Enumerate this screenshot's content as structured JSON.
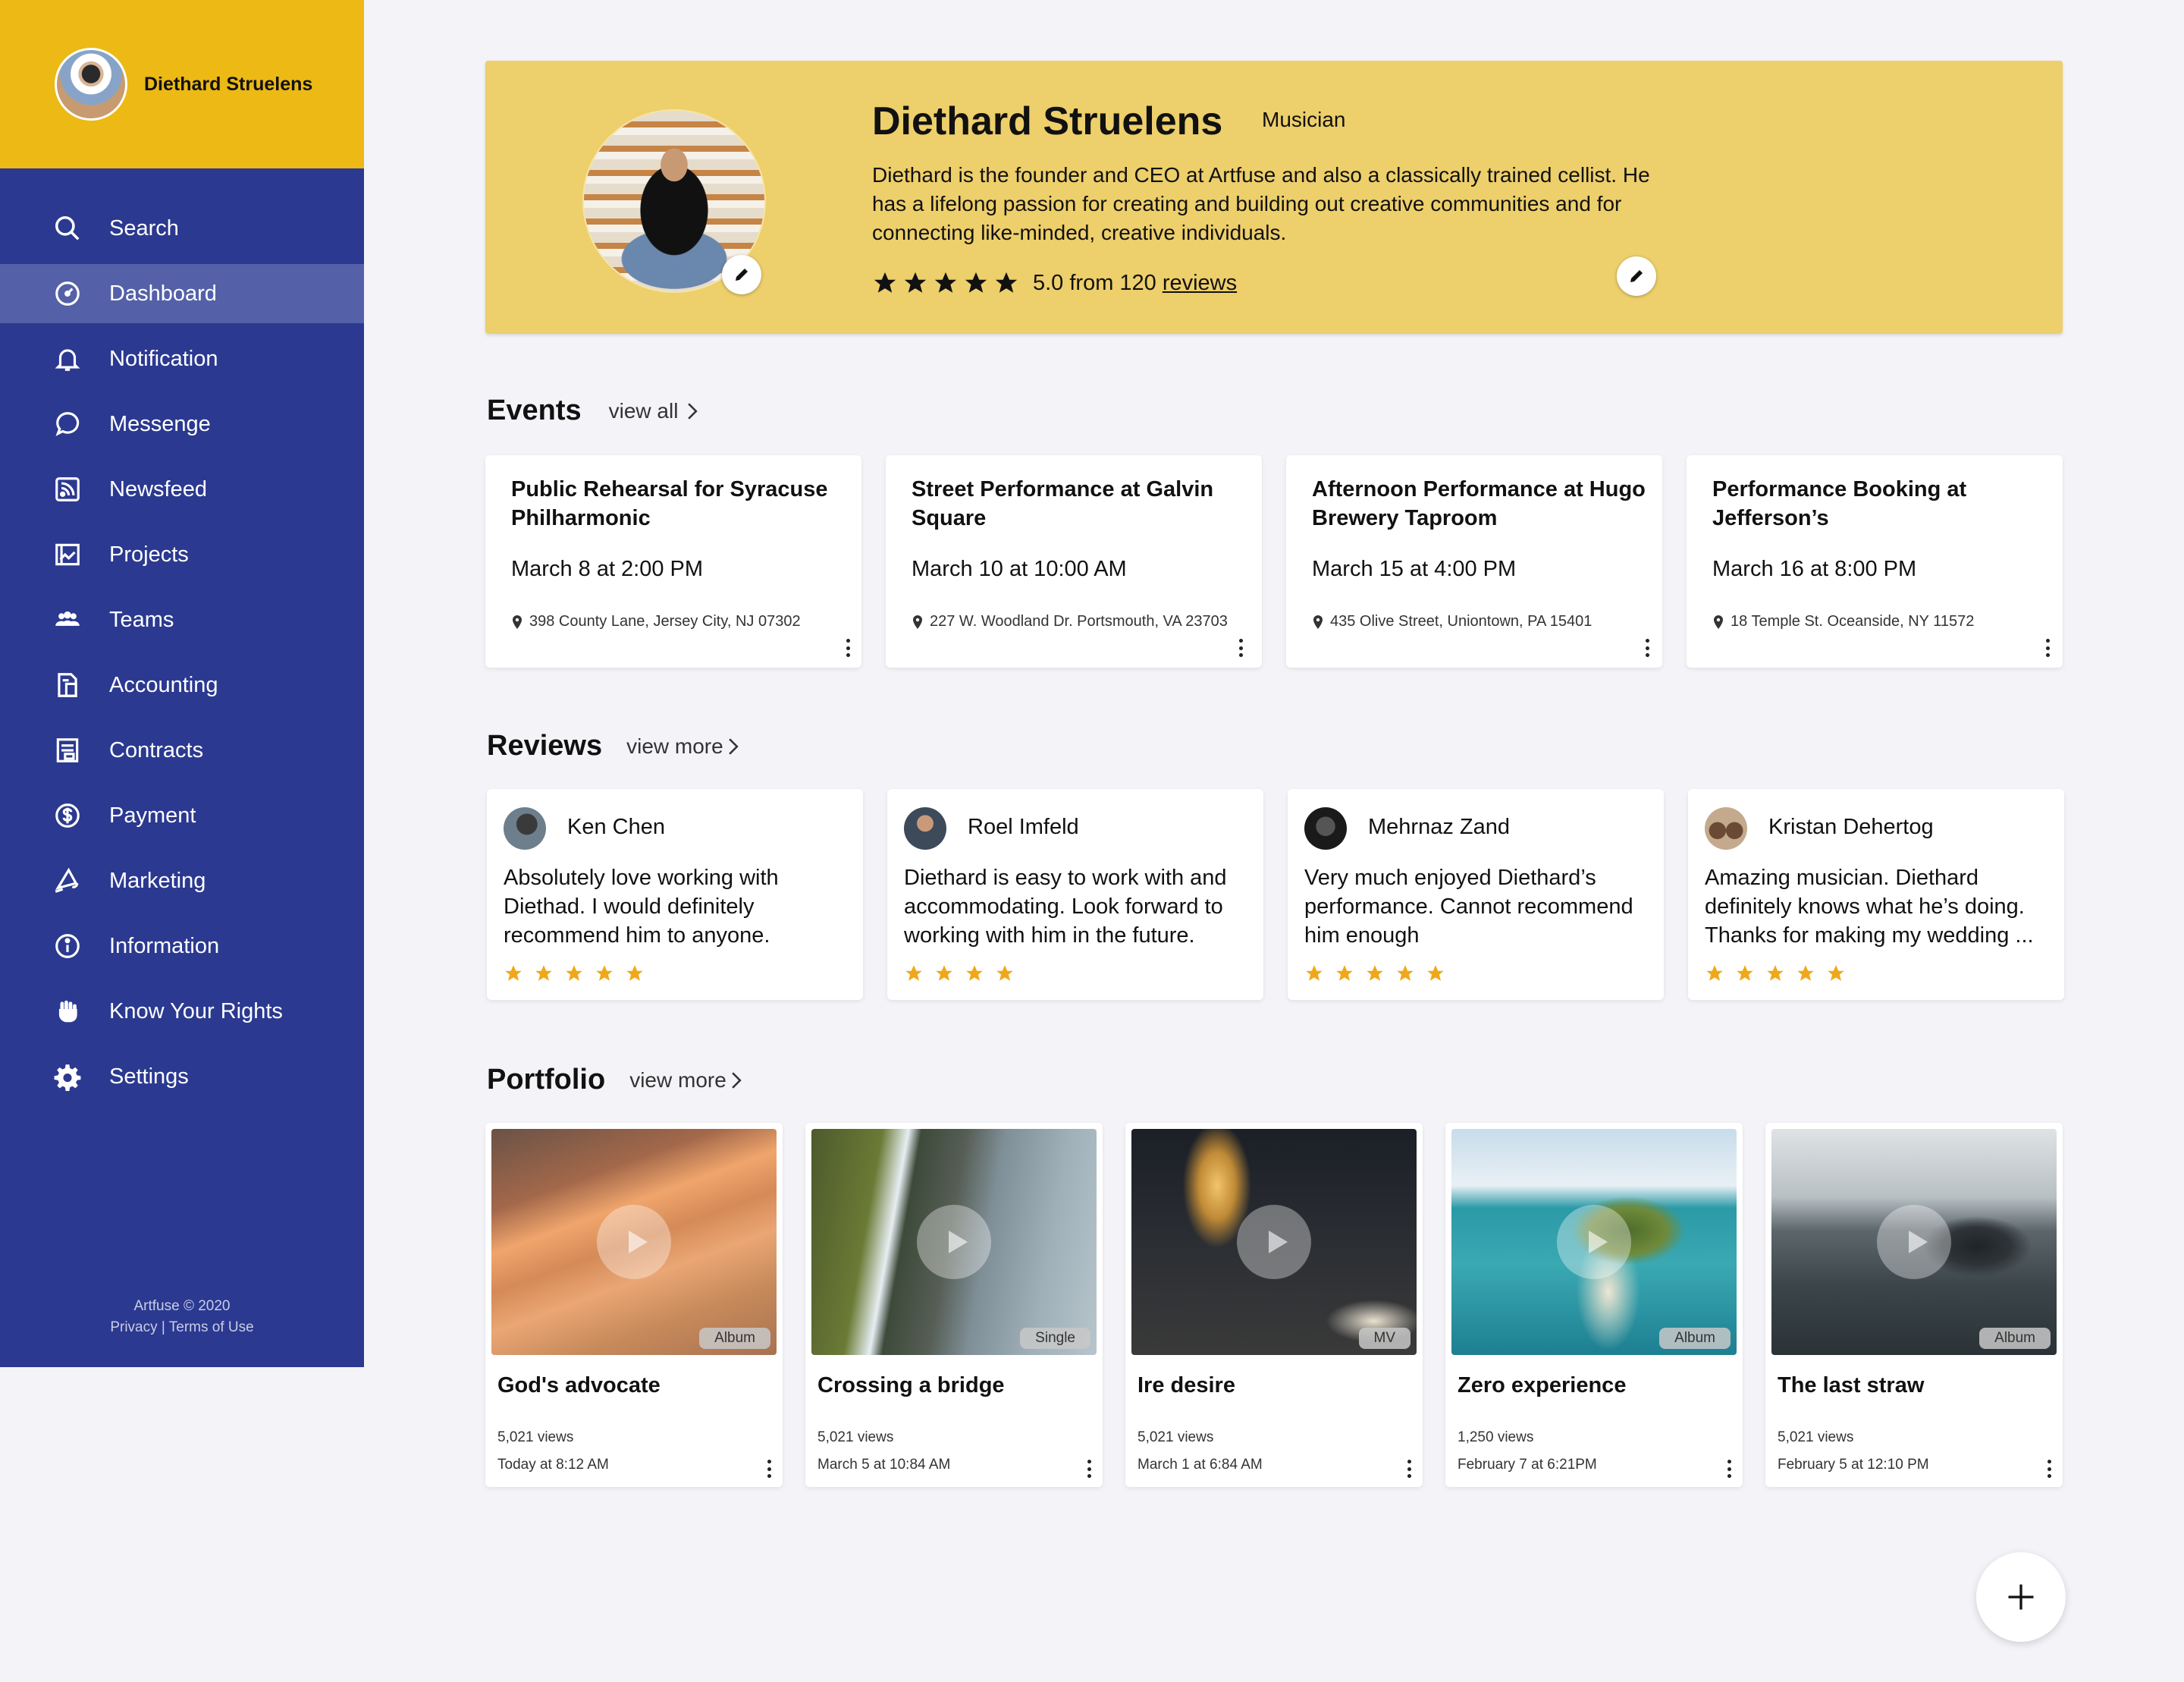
{
  "sidebar": {
    "user_name": "Diethard Struelens",
    "items": [
      {
        "label": "Search",
        "icon": "search-icon"
      },
      {
        "label": "Dashboard",
        "icon": "dashboard-icon",
        "active": true
      },
      {
        "label": "Notification",
        "icon": "bell-icon"
      },
      {
        "label": "Messenge",
        "icon": "chat-icon"
      },
      {
        "label": "Newsfeed",
        "icon": "rss-icon"
      },
      {
        "label": "Projects",
        "icon": "projects-icon"
      },
      {
        "label": "Teams",
        "icon": "teams-icon"
      },
      {
        "label": "Accounting",
        "icon": "accounting-icon"
      },
      {
        "label": "Contracts",
        "icon": "contracts-icon"
      },
      {
        "label": "Payment",
        "icon": "dollar-icon"
      },
      {
        "label": "Marketing",
        "icon": "megaphone-icon"
      },
      {
        "label": "Information",
        "icon": "info-icon"
      },
      {
        "label": "Know Your Rights",
        "icon": "fist-icon"
      },
      {
        "label": "Settings",
        "icon": "gear-icon"
      }
    ],
    "footer_copyright": "Artfuse © 2020",
    "footer_links": "Privacy | Terms of Use"
  },
  "profile": {
    "name": "Diethard Struelens",
    "role": "Musician",
    "bio": "Diethard is the founder and CEO at Artfuse and also a classically trained cellist. He has a lifelong passion for creating and building out creative communities and for connecting like-minded, creative individuals.",
    "rating_text": "5.0 from 120",
    "reviews_link": "reviews",
    "rating_stars": 5
  },
  "events": {
    "title": "Events",
    "view_all": "view all",
    "items": [
      {
        "title": "Public Rehearsal for Syracuse Philharmonic",
        "date": "March 8 at 2:00 PM",
        "address": "398 County Lane, Jersey City, NJ 07302"
      },
      {
        "title": "Street Performance at Galvin Square",
        "date": "March 10 at 10:00 AM",
        "address": "227 W. Woodland Dr. Portsmouth, VA 23703"
      },
      {
        "title": "Afternoon Performance at Hugo Brewery Taproom",
        "date": "March 15 at 4:00 PM",
        "address": "435 Olive Street, Uniontown, PA 15401"
      },
      {
        "title": "Performance Booking at Jefferson’s",
        "date": "March 16 at 8:00 PM",
        "address": "18 Temple St. Oceanside, NY 11572"
      }
    ]
  },
  "reviews": {
    "title": "Reviews",
    "view_more": "view more",
    "items": [
      {
        "name": "Ken Chen",
        "text": "Absolutely love working with Diethad. I would definitely recommend him to anyone.",
        "stars": 5
      },
      {
        "name": "Roel Imfeld",
        "text": "Diethard is easy to work with and accommodating. Look forward to working with him in the future.",
        "stars": 4
      },
      {
        "name": "Mehrnaz Zand",
        "text": "Very much enjoyed Diethard’s performance. Cannot recommend him enough",
        "stars": 5
      },
      {
        "name": "Kristan Dehertog",
        "text": "Amazing musician. Diethard definitely knows what he’s doing. Thanks for making my wedding ...",
        "stars": 5
      }
    ]
  },
  "portfolio": {
    "title": "Portfolio",
    "view_more": "view more",
    "items": [
      {
        "title": "God's advocate",
        "views": "5,021 views",
        "date": "Today at 8:12 AM",
        "badge": "Album"
      },
      {
        "title": "Crossing a bridge",
        "views": "5,021 views",
        "date": "March 5 at 10:84 AM",
        "badge": "Single"
      },
      {
        "title": "Ire desire",
        "views": "5,021 views",
        "date": "March 1 at 6:84 AM",
        "badge": "MV"
      },
      {
        "title": "Zero experience",
        "views": "1,250 views",
        "date": "February 7 at 6:21PM",
        "badge": "Album"
      },
      {
        "title": "The last straw",
        "views": "5,021 views",
        "date": "February 5 at 12:10 PM",
        "badge": "Album"
      }
    ]
  },
  "colors": {
    "sidebar_bg": "#2b3990",
    "sidebar_head": "#ecb915",
    "profile_bg": "#edcf6b",
    "star_gold": "#f0a818",
    "page_bg": "#f3f3f8"
  }
}
